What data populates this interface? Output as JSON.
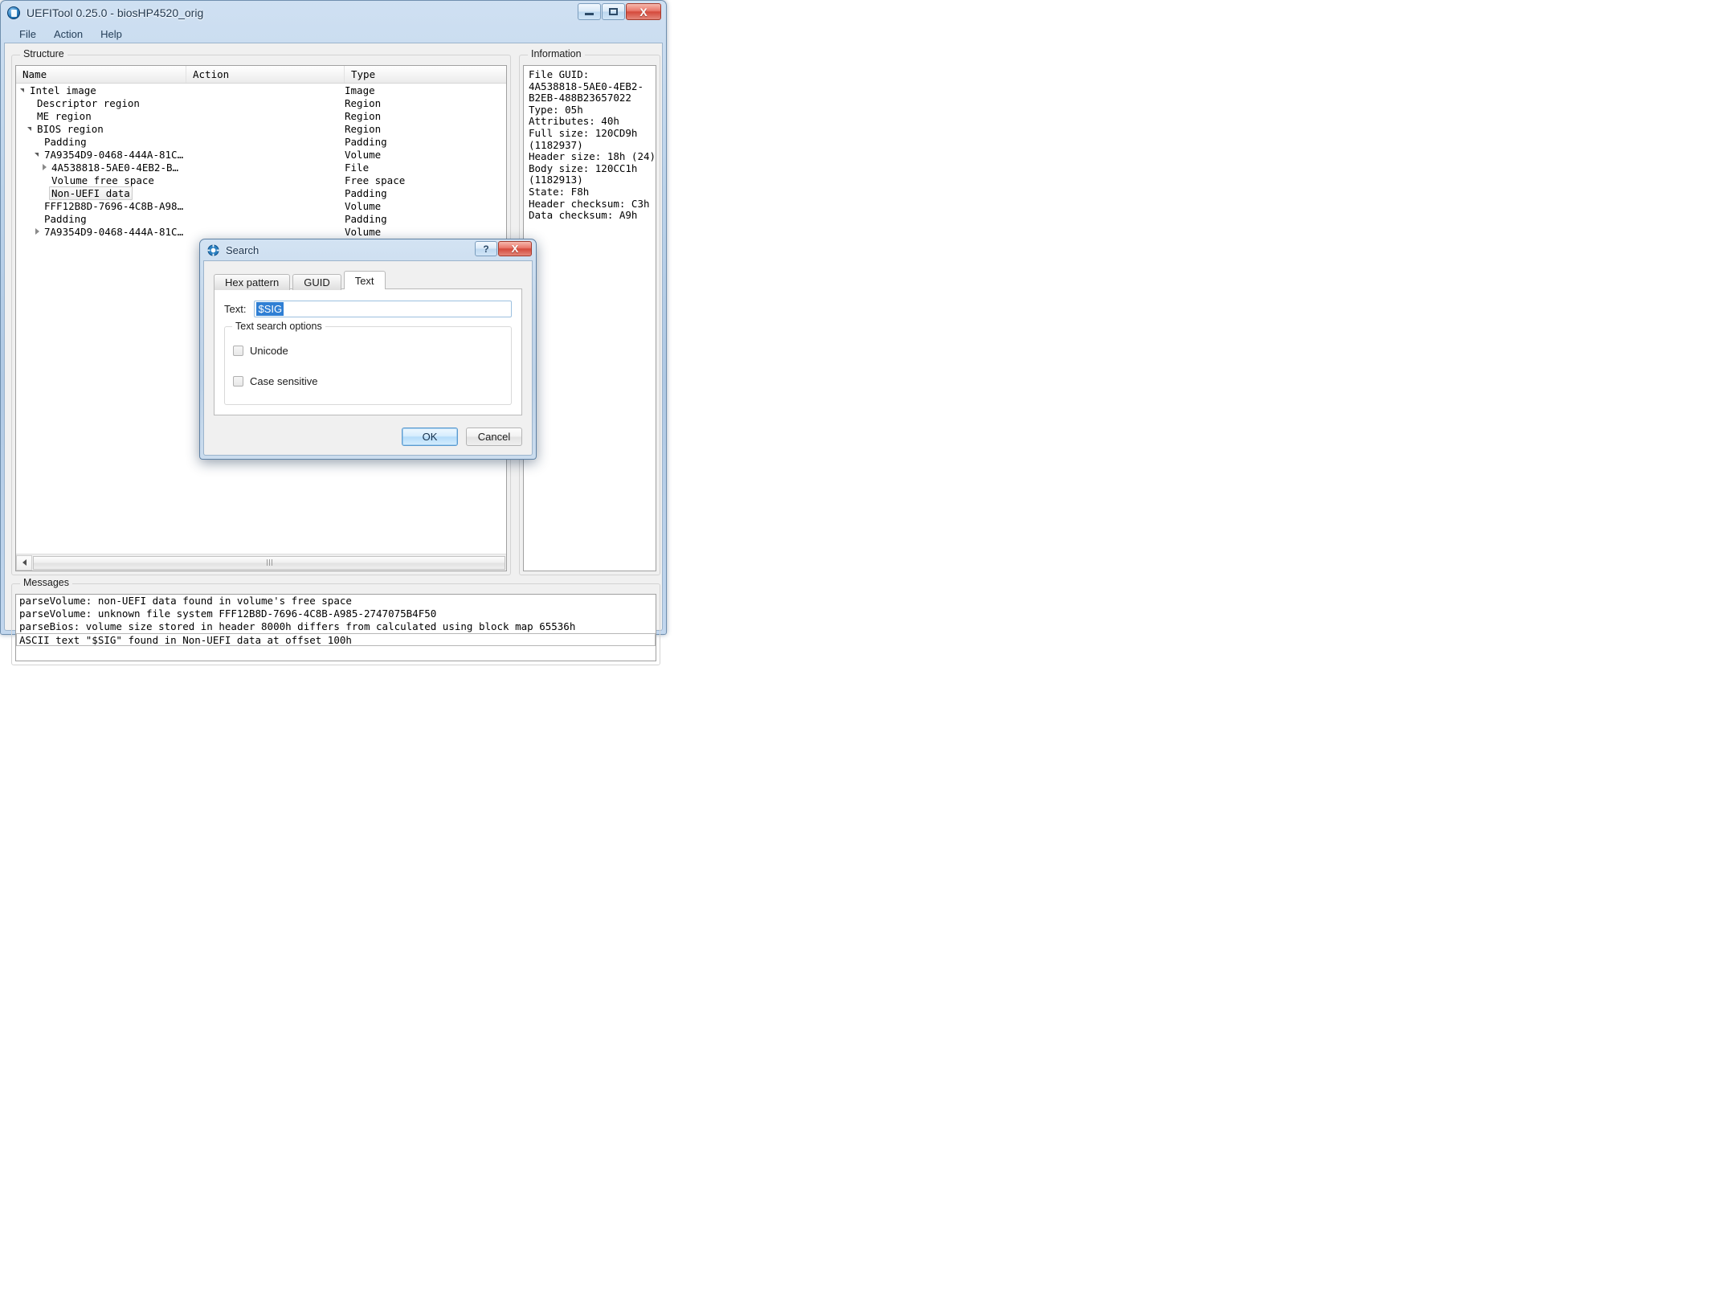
{
  "window": {
    "title": "UEFITool 0.25.0 - biosHP4520_orig",
    "icon": "uefitool-app-icon",
    "controls": {
      "minimize": "minimize-icon",
      "maximize": "maximize-icon",
      "close": "X"
    }
  },
  "menu": {
    "items": [
      {
        "label": "File"
      },
      {
        "label": "Action"
      },
      {
        "label": "Help"
      }
    ]
  },
  "structure": {
    "group_title": "Structure",
    "columns": [
      "Name",
      "Action",
      "Type"
    ],
    "rows": [
      {
        "name": "Intel image",
        "action": "",
        "type": "Image",
        "indent": 0,
        "twisty": "open",
        "selected": false
      },
      {
        "name": "Descriptor region",
        "action": "",
        "type": "Region",
        "indent": 1,
        "twisty": "none",
        "selected": false
      },
      {
        "name": "ME region",
        "action": "",
        "type": "Region",
        "indent": 1,
        "twisty": "none",
        "selected": false
      },
      {
        "name": "BIOS region",
        "action": "",
        "type": "Region",
        "indent": 1,
        "twisty": "open",
        "selected": false
      },
      {
        "name": "Padding",
        "action": "",
        "type": "Padding",
        "indent": 2,
        "twisty": "none",
        "selected": false
      },
      {
        "name": "7A9354D9-0468-444A-81C…",
        "action": "",
        "type": "Volume",
        "indent": 2,
        "twisty": "open",
        "selected": false
      },
      {
        "name": "4A538818-5AE0-4EB2-B…",
        "action": "",
        "type": "File",
        "indent": 3,
        "twisty": "closed",
        "selected": false
      },
      {
        "name": "Volume free space",
        "action": "",
        "type": "Free space",
        "indent": 3,
        "twisty": "none",
        "selected": false
      },
      {
        "name": "Non-UEFI data",
        "action": "",
        "type": "Padding",
        "indent": 3,
        "twisty": "none",
        "selected": true
      },
      {
        "name": "FFF12B8D-7696-4C8B-A98…",
        "action": "",
        "type": "Volume",
        "indent": 2,
        "twisty": "none",
        "selected": false
      },
      {
        "name": "Padding",
        "action": "",
        "type": "Padding",
        "indent": 2,
        "twisty": "none",
        "selected": false
      },
      {
        "name": "7A9354D9-0468-444A-81C…",
        "action": "",
        "type": "Volume",
        "indent": 2,
        "twisty": "closed",
        "selected": false
      }
    ],
    "hscroll": {
      "left_arrow": "scroll-left-icon",
      "thumb": "scroll-thumb"
    }
  },
  "information": {
    "group_title": "Information",
    "text": "File GUID:\n4A538818-5AE0-4EB2-\nB2EB-488B23657022\nType: 05h\nAttributes: 40h\nFull size: 120CD9h\n(1182937)\nHeader size: 18h (24)\nBody size: 120CC1h\n(1182913)\nState: F8h\nHeader checksum: C3h\nData checksum: A9h"
  },
  "messages": {
    "group_title": "Messages",
    "rows": [
      {
        "text": "parseVolume: non-UEFI data found in volume's free space",
        "selected": false
      },
      {
        "text": "parseVolume: unknown file system FFF12B8D-7696-4C8B-A985-2747075B4F50",
        "selected": false
      },
      {
        "text": "parseBios: volume size stored in header 8000h differs from calculated using block map 65536h",
        "selected": false
      },
      {
        "text": "ASCII text \"$SIG\" found in Non-UEFI data at offset 100h",
        "selected": true
      }
    ]
  },
  "search_dialog": {
    "title": "Search",
    "icon": "gear-icon",
    "controls": {
      "help": "?",
      "close": "X"
    },
    "tabs": [
      {
        "label": "Hex pattern",
        "active": false
      },
      {
        "label": "GUID",
        "active": false
      },
      {
        "label": "Text",
        "active": true
      }
    ],
    "text_field": {
      "label": "Text:",
      "value": "$SIG",
      "placeholder": ""
    },
    "options": {
      "group_title": "Text search options",
      "checkboxes": [
        {
          "label": "Unicode",
          "checked": false
        },
        {
          "label": "Case sensitive",
          "checked": false
        }
      ]
    },
    "buttons": {
      "ok": "OK",
      "cancel": "Cancel"
    }
  },
  "colors": {
    "selection_blue": "#2f7fd4",
    "titlebar_blue": "#bcd3ea",
    "close_red": "#d44a3c"
  }
}
